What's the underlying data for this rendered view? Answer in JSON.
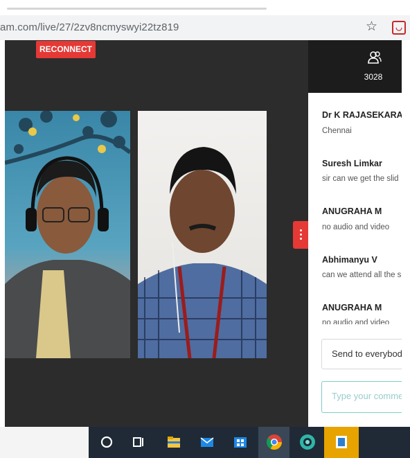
{
  "browser": {
    "url": "am.com/live/27/2zv8ncmyswyi22tz819",
    "star_icon": "star-icon",
    "extension_icon": "shield-extension-icon"
  },
  "stage": {
    "reconnect_label": "RECONNECT"
  },
  "participants": {
    "count": "3028",
    "icon": "people-icon"
  },
  "chat": {
    "messages": [
      {
        "name": "Dr K RAJASEKARAN",
        "text": "Chennai"
      },
      {
        "name": "Suresh Limkar",
        "text": "sir can we get the slid"
      },
      {
        "name": "ANUGRAHA M",
        "text": "no audio and video"
      },
      {
        "name": "Abhimanyu V",
        "text": "can we attend all the s"
      },
      {
        "name": "ANUGRAHA M",
        "text": "no audio and video"
      }
    ],
    "send_to": "Send to everybody",
    "comment_placeholder": "Type your comme"
  },
  "colors": {
    "accent_red": "#e53935",
    "stage_bg": "#2c2c2c",
    "taskbar_bg": "#1f2a36"
  },
  "taskbar": {
    "icons": [
      "cortana-circle-icon",
      "task-view-icon",
      "file-explorer-icon",
      "mail-icon",
      "store-icon",
      "chrome-icon",
      "edge-icon",
      "app-icon"
    ]
  }
}
